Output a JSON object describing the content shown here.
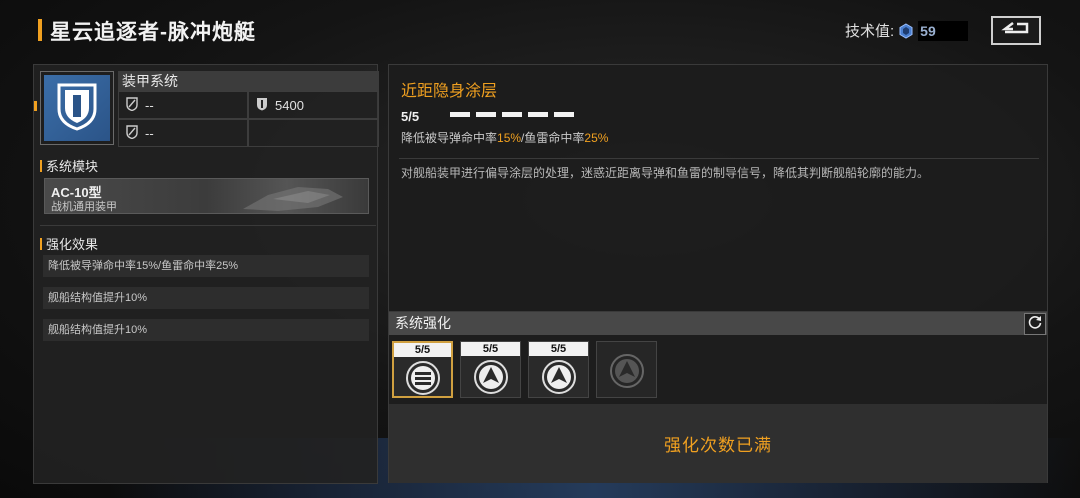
{
  "header": {
    "title": "星云追逐者-脉冲炮艇",
    "tech_label": "技术值:",
    "tech_value": "59",
    "tech_icon": "gem-icon",
    "back_icon": "back-arrow-icon"
  },
  "left": {
    "armor_icon": "shield-icon",
    "armor_title": "装甲系统",
    "stats": [
      {
        "icon": "shield-slash-icon",
        "value": "--"
      },
      {
        "icon": "shield-hp-icon",
        "value": "5400"
      },
      {
        "icon": "shield-slash-icon",
        "value": "--"
      },
      {
        "icon": "",
        "value": ""
      }
    ],
    "module_section": "系统模块",
    "module": {
      "name": "AC-10型",
      "sub": "战机通用装甲"
    },
    "effect_section": "强化效果",
    "effects": [
      "降低被导弹命中率15%/鱼雷命中率25%",
      "舰船结构值提升10%",
      "舰船结构值提升10%"
    ]
  },
  "skill": {
    "title": "近距隐身涂层",
    "level": "5/5",
    "level_filled": 5,
    "level_total": 5,
    "effect_prefix": "降低被导弹命中率",
    "effect_val1": "15%",
    "effect_mid": "/鱼雷命中率",
    "effect_val2": "25%",
    "description": "对舰船装甲进行偏导涂层的处理，迷惑近距离导弹和鱼雷的制导信号，降低其判断舰船轮廓的能力。"
  },
  "enhance": {
    "title": "系统强化",
    "refresh_icon": "refresh-icon",
    "nodes": [
      {
        "count": "5/5",
        "icon": "stripes-emblem-icon",
        "selected": true
      },
      {
        "count": "5/5",
        "icon": "ship-emblem-icon",
        "selected": false
      },
      {
        "count": "5/5",
        "icon": "ship-emblem-icon",
        "selected": false
      },
      {
        "count": "",
        "icon": "ship-emblem-locked-icon",
        "selected": false
      }
    ],
    "max_text": "强化次数已满"
  },
  "colors": {
    "accent": "#f0a020",
    "armor_blue": "#3b6ea8"
  }
}
